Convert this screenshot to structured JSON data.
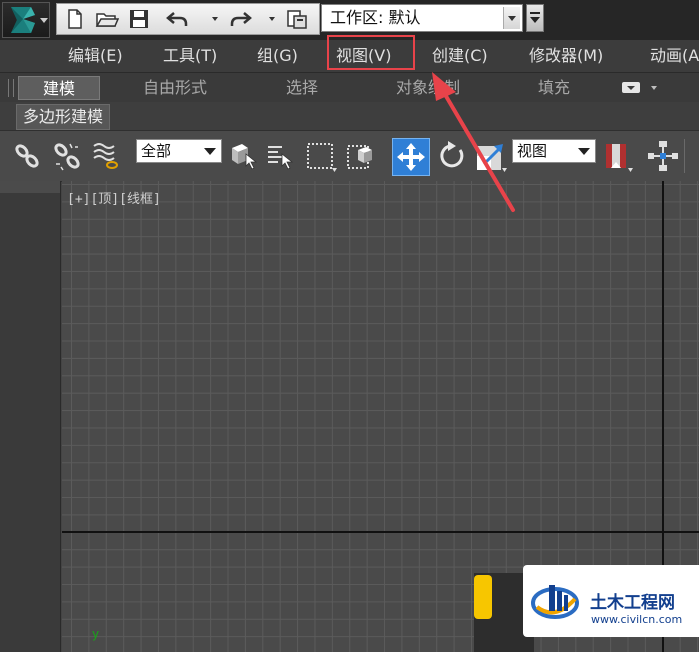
{
  "window": {
    "quick_access_tools": [
      "new-file",
      "open-file",
      "save",
      "undo",
      "redo",
      "project-folder"
    ],
    "workspace_label": "工作区: 默认"
  },
  "menu": {
    "items": [
      "编辑(E)",
      "工具(T)",
      "组(G)",
      "视图(V)",
      "创建(C)",
      "修改器(M)",
      "动画(A"
    ],
    "highlighted": "视图(V)",
    "highlight_color": "#e8434a"
  },
  "ribbon": {
    "tabs": [
      "建模",
      "自由形式",
      "选择",
      "对象绘制",
      "填充"
    ],
    "active_tab": "建模",
    "sub_label": "多边形建模"
  },
  "toolbar": {
    "selection_filter": "全部",
    "reference_coord": "视图",
    "active_tool": "select-and-move",
    "active_color": "#2f7fd6"
  },
  "viewport": {
    "label": "[+][顶][线框]",
    "axis_marker": "y"
  },
  "watermark": {
    "title": "土木工程网",
    "url": "www.civilcn.com"
  },
  "annotation": {
    "arrow_color": "#e8434a"
  }
}
